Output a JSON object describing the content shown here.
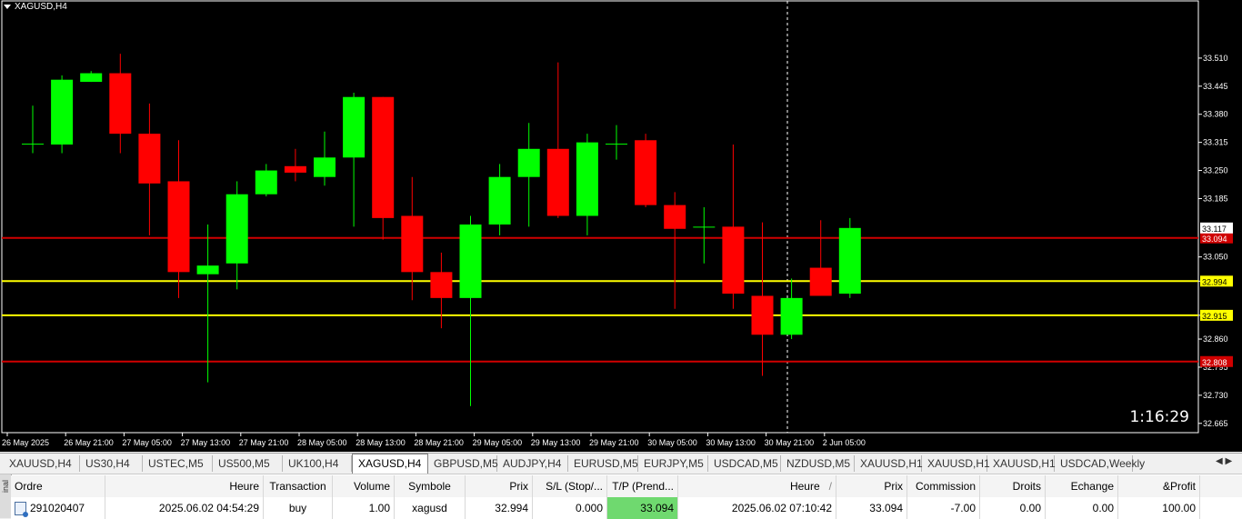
{
  "chart": {
    "symbol_label": "XAGUSD,H4",
    "countdown": "1:16:29"
  },
  "chart_data": {
    "type": "candlestick",
    "symbol": "XAGUSD",
    "timeframe": "H4",
    "ylim": [
      32.665,
      33.575
    ],
    "y_ticks": [
      "33.510",
      "33.445",
      "33.380",
      "33.315",
      "33.250",
      "33.185",
      "33.117",
      "33.050",
      "32.994",
      "32.915",
      "32.860",
      "32.795",
      "32.730",
      "32.665"
    ],
    "x_ticks": [
      "26 May 2025",
      "26 May 21:00",
      "27 May 05:00",
      "27 May 13:00",
      "27 May 21:00",
      "28 May 05:00",
      "28 May 13:00",
      "28 May 21:00",
      "29 May 05:00",
      "29 May 13:00",
      "29 May 21:00",
      "30 May 05:00",
      "30 May 13:00",
      "30 May 21:00",
      "2 Jun 05:00"
    ],
    "candles": [
      {
        "o": 33.312,
        "h": 33.4,
        "l": 33.29,
        "c": 33.312
      },
      {
        "o": 33.31,
        "h": 33.47,
        "l": 33.29,
        "c": 33.46
      },
      {
        "o": 33.455,
        "h": 33.48,
        "l": 33.455,
        "c": 33.475
      },
      {
        "o": 33.475,
        "h": 33.52,
        "l": 33.29,
        "c": 33.335
      },
      {
        "o": 33.335,
        "h": 33.405,
        "l": 33.1,
        "c": 33.22
      },
      {
        "o": 33.225,
        "h": 33.32,
        "l": 32.955,
        "c": 33.015
      },
      {
        "o": 33.01,
        "h": 33.125,
        "l": 32.76,
        "c": 33.03
      },
      {
        "o": 33.035,
        "h": 33.225,
        "l": 32.975,
        "c": 33.195
      },
      {
        "o": 33.195,
        "h": 33.265,
        "l": 33.19,
        "c": 33.25
      },
      {
        "o": 33.26,
        "h": 33.3,
        "l": 33.225,
        "c": 33.245
      },
      {
        "o": 33.235,
        "h": 33.34,
        "l": 33.215,
        "c": 33.28
      },
      {
        "o": 33.28,
        "h": 33.43,
        "l": 33.12,
        "c": 33.42
      },
      {
        "o": 33.42,
        "h": 33.42,
        "l": 33.09,
        "c": 33.14
      },
      {
        "o": 33.145,
        "h": 33.235,
        "l": 32.95,
        "c": 33.015
      },
      {
        "o": 33.015,
        "h": 33.06,
        "l": 32.885,
        "c": 32.955
      },
      {
        "o": 32.955,
        "h": 33.145,
        "l": 32.705,
        "c": 33.125
      },
      {
        "o": 33.125,
        "h": 33.265,
        "l": 33.1,
        "c": 33.235
      },
      {
        "o": 33.235,
        "h": 33.36,
        "l": 33.12,
        "c": 33.3
      },
      {
        "o": 33.3,
        "h": 33.5,
        "l": 33.14,
        "c": 33.145
      },
      {
        "o": 33.145,
        "h": 33.335,
        "l": 33.1,
        "c": 33.315
      },
      {
        "o": 33.31,
        "h": 33.355,
        "l": 33.275,
        "c": 33.312
      },
      {
        "o": 33.32,
        "h": 33.335,
        "l": 33.165,
        "c": 33.17
      },
      {
        "o": 33.17,
        "h": 33.2,
        "l": 32.93,
        "c": 33.115
      },
      {
        "o": 33.12,
        "h": 33.165,
        "l": 33.035,
        "c": 33.12
      },
      {
        "o": 33.12,
        "h": 33.31,
        "l": 32.93,
        "c": 32.965
      },
      {
        "o": 32.96,
        "h": 33.13,
        "l": 32.775,
        "c": 32.87
      },
      {
        "o": 32.87,
        "h": 33.0,
        "l": 32.86,
        "c": 32.955
      },
      {
        "o": 33.025,
        "h": 33.135,
        "l": 32.96,
        "c": 32.96
      },
      {
        "o": 32.965,
        "h": 33.14,
        "l": 32.955,
        "c": 33.117
      }
    ],
    "hlines": [
      {
        "price": 33.094,
        "color": "#d00000",
        "label": "33.094"
      },
      {
        "price": 32.994,
        "color": "#ffff00",
        "label": "32.994"
      },
      {
        "price": 32.915,
        "color": "#ffff00",
        "label": "32.915"
      },
      {
        "price": 32.808,
        "color": "#d00000",
        "label": "32.808"
      }
    ],
    "current_price": "33.117",
    "bull_color": "#00ff00",
    "bear_color": "#ff0000"
  },
  "tabs": [
    "XAUUSD,H4",
    "US30,H4",
    "USTEC,M5",
    "US500,M5",
    "UK100,H4",
    "XAGUSD,H4",
    "GBPUSD,M5",
    "AUDJPY,H4",
    "EURUSD,M5",
    "EURJPY,M5",
    "USDCAD,M5",
    "NZDUSD,M5",
    "XAUUSD,H1",
    "XAUUSD,H1",
    "XAUUSD,H1",
    "USDCAD,Weekly"
  ],
  "orders": {
    "side_label": "inal",
    "headers": [
      "Ordre",
      "Heure",
      "Transaction",
      "Volume",
      "Symbole",
      "Prix",
      "S/L (Stop/...",
      "T/P (Prend...",
      "Heure",
      "Prix",
      "Commission",
      "Droits",
      "Echange",
      "&Profit"
    ],
    "sort_mark": "/",
    "row": [
      "291020407",
      "2025.06.02 04:54:29",
      "buy",
      "1.00",
      "xagusd",
      "32.994",
      "0.000",
      "33.094",
      "2025.06.02 07:10:42",
      "33.094",
      "-7.00",
      "0.00",
      "0.00",
      "100.00"
    ]
  }
}
